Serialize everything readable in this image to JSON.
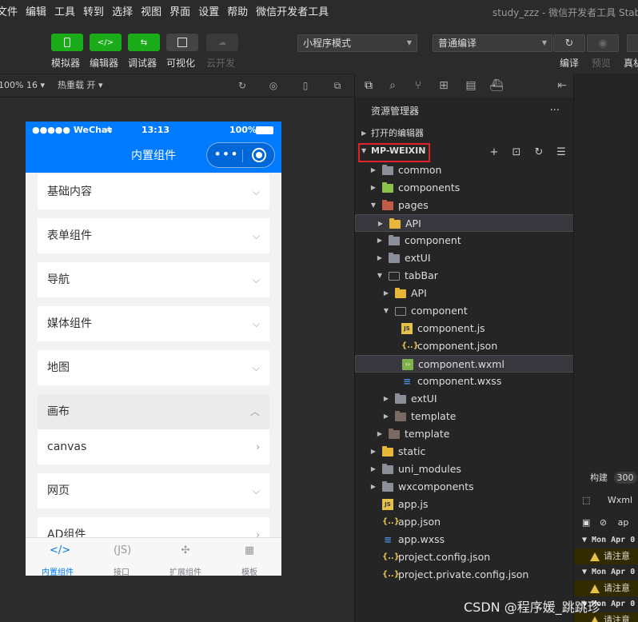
{
  "menubar": {
    "items": [
      "文件",
      "编辑",
      "工具",
      "转到",
      "选择",
      "视图",
      "界面",
      "设置",
      "帮助",
      "微信开发者工具"
    ],
    "window_title": "study_zzz - 微信开发者工具 Stable"
  },
  "toolbar": {
    "buttons": [
      {
        "label": "模拟器",
        "icon": "phone-icon"
      },
      {
        "label": "编辑器",
        "icon": "code-icon"
      },
      {
        "label": "调试器",
        "icon": "debug-icon"
      },
      {
        "label": "可视化",
        "icon": "layout-icon"
      },
      {
        "label": "云开发",
        "icon": "cloud-icon"
      }
    ],
    "mode_select": "小程序模式",
    "compile_select": "普通编译",
    "right_labels": [
      "编译",
      "预览",
      "真机"
    ]
  },
  "sim_bar": {
    "zoom": "100% 16",
    "hot_reload": "热重载 开"
  },
  "phone": {
    "carrier": "●●●●● WeChat",
    "time": "13:13",
    "battery": "100%",
    "nav_title": "内置组件",
    "capsule_dots": "•••",
    "items": [
      {
        "label": "基础内容",
        "chevron": "⌵"
      },
      {
        "label": "表单组件",
        "chevron": "⌵"
      },
      {
        "label": "导航",
        "chevron": "⌵"
      },
      {
        "label": "媒体组件",
        "chevron": "⌵"
      },
      {
        "label": "地图",
        "chevron": "⌵"
      },
      {
        "label": "画布",
        "chevron": "︿"
      },
      {
        "label": "canvas",
        "chevron": "›"
      },
      {
        "label": "网页",
        "chevron": "⌵"
      },
      {
        "label": "AD组件",
        "chevron": "›"
      }
    ],
    "tabs": [
      {
        "label": "内置组件",
        "icon": "</>"
      },
      {
        "label": "接口",
        "icon": "(JS)"
      },
      {
        "label": "扩展组件",
        "icon": "✣"
      },
      {
        "label": "模板",
        "icon": "▦"
      }
    ]
  },
  "explorer": {
    "title": "资源管理器",
    "more": "···",
    "open_editors": "打开的编辑器",
    "root": "MP-WEIXIN",
    "tree": [
      {
        "label": "common",
        "depth": 0,
        "caret": "▶",
        "icon": "folder"
      },
      {
        "label": "components",
        "depth": 0,
        "caret": "▶",
        "icon": "fold-g"
      },
      {
        "label": "pages",
        "depth": 0,
        "caret": "▼",
        "icon": "fold-r"
      },
      {
        "label": "API",
        "depth": 1,
        "caret": "▶",
        "icon": "fold-y",
        "selected": true
      },
      {
        "label": "component",
        "depth": 1,
        "caret": "▶",
        "icon": "folder"
      },
      {
        "label": "extUI",
        "depth": 1,
        "caret": "▶",
        "icon": "folder"
      },
      {
        "label": "tabBar",
        "depth": 1,
        "caret": "▼",
        "icon": "fold-o"
      },
      {
        "label": "API",
        "depth": 2,
        "caret": "▶",
        "icon": "fold-y"
      },
      {
        "label": "component",
        "depth": 2,
        "caret": "▼",
        "icon": "fold-o"
      },
      {
        "label": "component.js",
        "depth": 3,
        "caret": "",
        "icon": "js"
      },
      {
        "label": "component.json",
        "depth": 3,
        "caret": "",
        "icon": "json"
      },
      {
        "label": "component.wxml",
        "depth": 3,
        "caret": "",
        "icon": "wxml",
        "selected": true
      },
      {
        "label": "component.wxss",
        "depth": 3,
        "caret": "",
        "icon": "css"
      },
      {
        "label": "extUI",
        "depth": 2,
        "caret": "▶",
        "icon": "folder"
      },
      {
        "label": "template",
        "depth": 2,
        "caret": "▶",
        "icon": "fold-b"
      },
      {
        "label": "template",
        "depth": 1,
        "caret": "▶",
        "icon": "fold-b"
      },
      {
        "label": "static",
        "depth": 0,
        "caret": "▶",
        "icon": "fold-y"
      },
      {
        "label": "uni_modules",
        "depth": 0,
        "caret": "▶",
        "icon": "folder"
      },
      {
        "label": "wxcomponents",
        "depth": 0,
        "caret": "▶",
        "icon": "folder"
      },
      {
        "label": "app.js",
        "depth": 0,
        "caret": "",
        "icon": "js"
      },
      {
        "label": "app.json",
        "depth": 0,
        "caret": "",
        "icon": "json"
      },
      {
        "label": "app.wxss",
        "depth": 0,
        "caret": "",
        "icon": "css"
      },
      {
        "label": "project.config.json",
        "depth": 0,
        "caret": "",
        "icon": "json"
      },
      {
        "label": "project.private.config.json",
        "depth": 0,
        "caret": "",
        "icon": "json"
      }
    ]
  },
  "console": {
    "build_label": "构建",
    "build_count": "300",
    "tab": "Wxml",
    "filter": "ap",
    "logs": [
      "Mon Apr 0",
      "请注意",
      "Mon Apr 0",
      "请注意",
      "Mon Apr 0",
      "请注意"
    ]
  },
  "watermark": "CSDN @程序媛_跳跳珍"
}
